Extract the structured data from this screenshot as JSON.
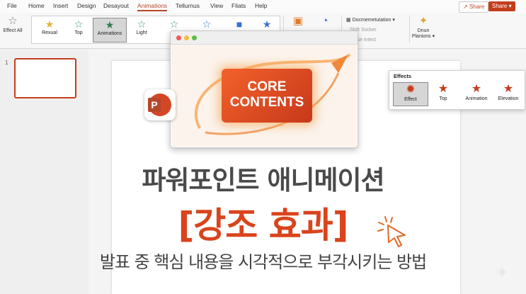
{
  "menu": {
    "items": [
      "File",
      "Home",
      "Insert",
      "Design",
      "Desayout",
      "Animations",
      "Tellurnus",
      "View",
      "Fliats",
      "Help"
    ],
    "active": "Animations",
    "share_label": "Share",
    "share2_label": "Share"
  },
  "ribbon": {
    "effect_all_label": "Effect All",
    "gallery": [
      {
        "label": "Rexual",
        "color": "#e0b53a"
      },
      {
        "label": "Top",
        "color": "#3a9a5e"
      },
      {
        "label": "Animations",
        "color": "#2f7d4f",
        "selected": true
      },
      {
        "label": "Light",
        "color": "#3a9a5e"
      },
      {
        "label": "",
        "color": "#3a9a5e"
      },
      {
        "label": "",
        "color": "#3a6fd0"
      },
      {
        "label": "",
        "color": "#3a6fd0"
      },
      {
        "label": "",
        "color": "#3a6fd0"
      }
    ],
    "docmentation_label": "Docmemetutation",
    "effect_socker": "Shift Socker",
    "close_intect": "Close Intect",
    "dnun_label": "Dnun",
    "planions_label": "Planions"
  },
  "thumbnails": {
    "slide_number": "1"
  },
  "popup": {
    "line1": "CORE",
    "line2": "CONTENTS"
  },
  "slide": {
    "title": "파워포인트 애니메이션",
    "emphasis": "[강조 효과]",
    "subtitle": "발표 중 핵심 내용을 시각적으로 부각시키는 방법"
  },
  "effects_panel": {
    "title": "Effects",
    "items": [
      {
        "label": "Effect",
        "selected": true
      },
      {
        "label": "Top"
      },
      {
        "label": "Animation"
      },
      {
        "label": "Elevation"
      }
    ]
  },
  "colors": {
    "accent": "#c43e1c",
    "orange": "#d9441c"
  }
}
